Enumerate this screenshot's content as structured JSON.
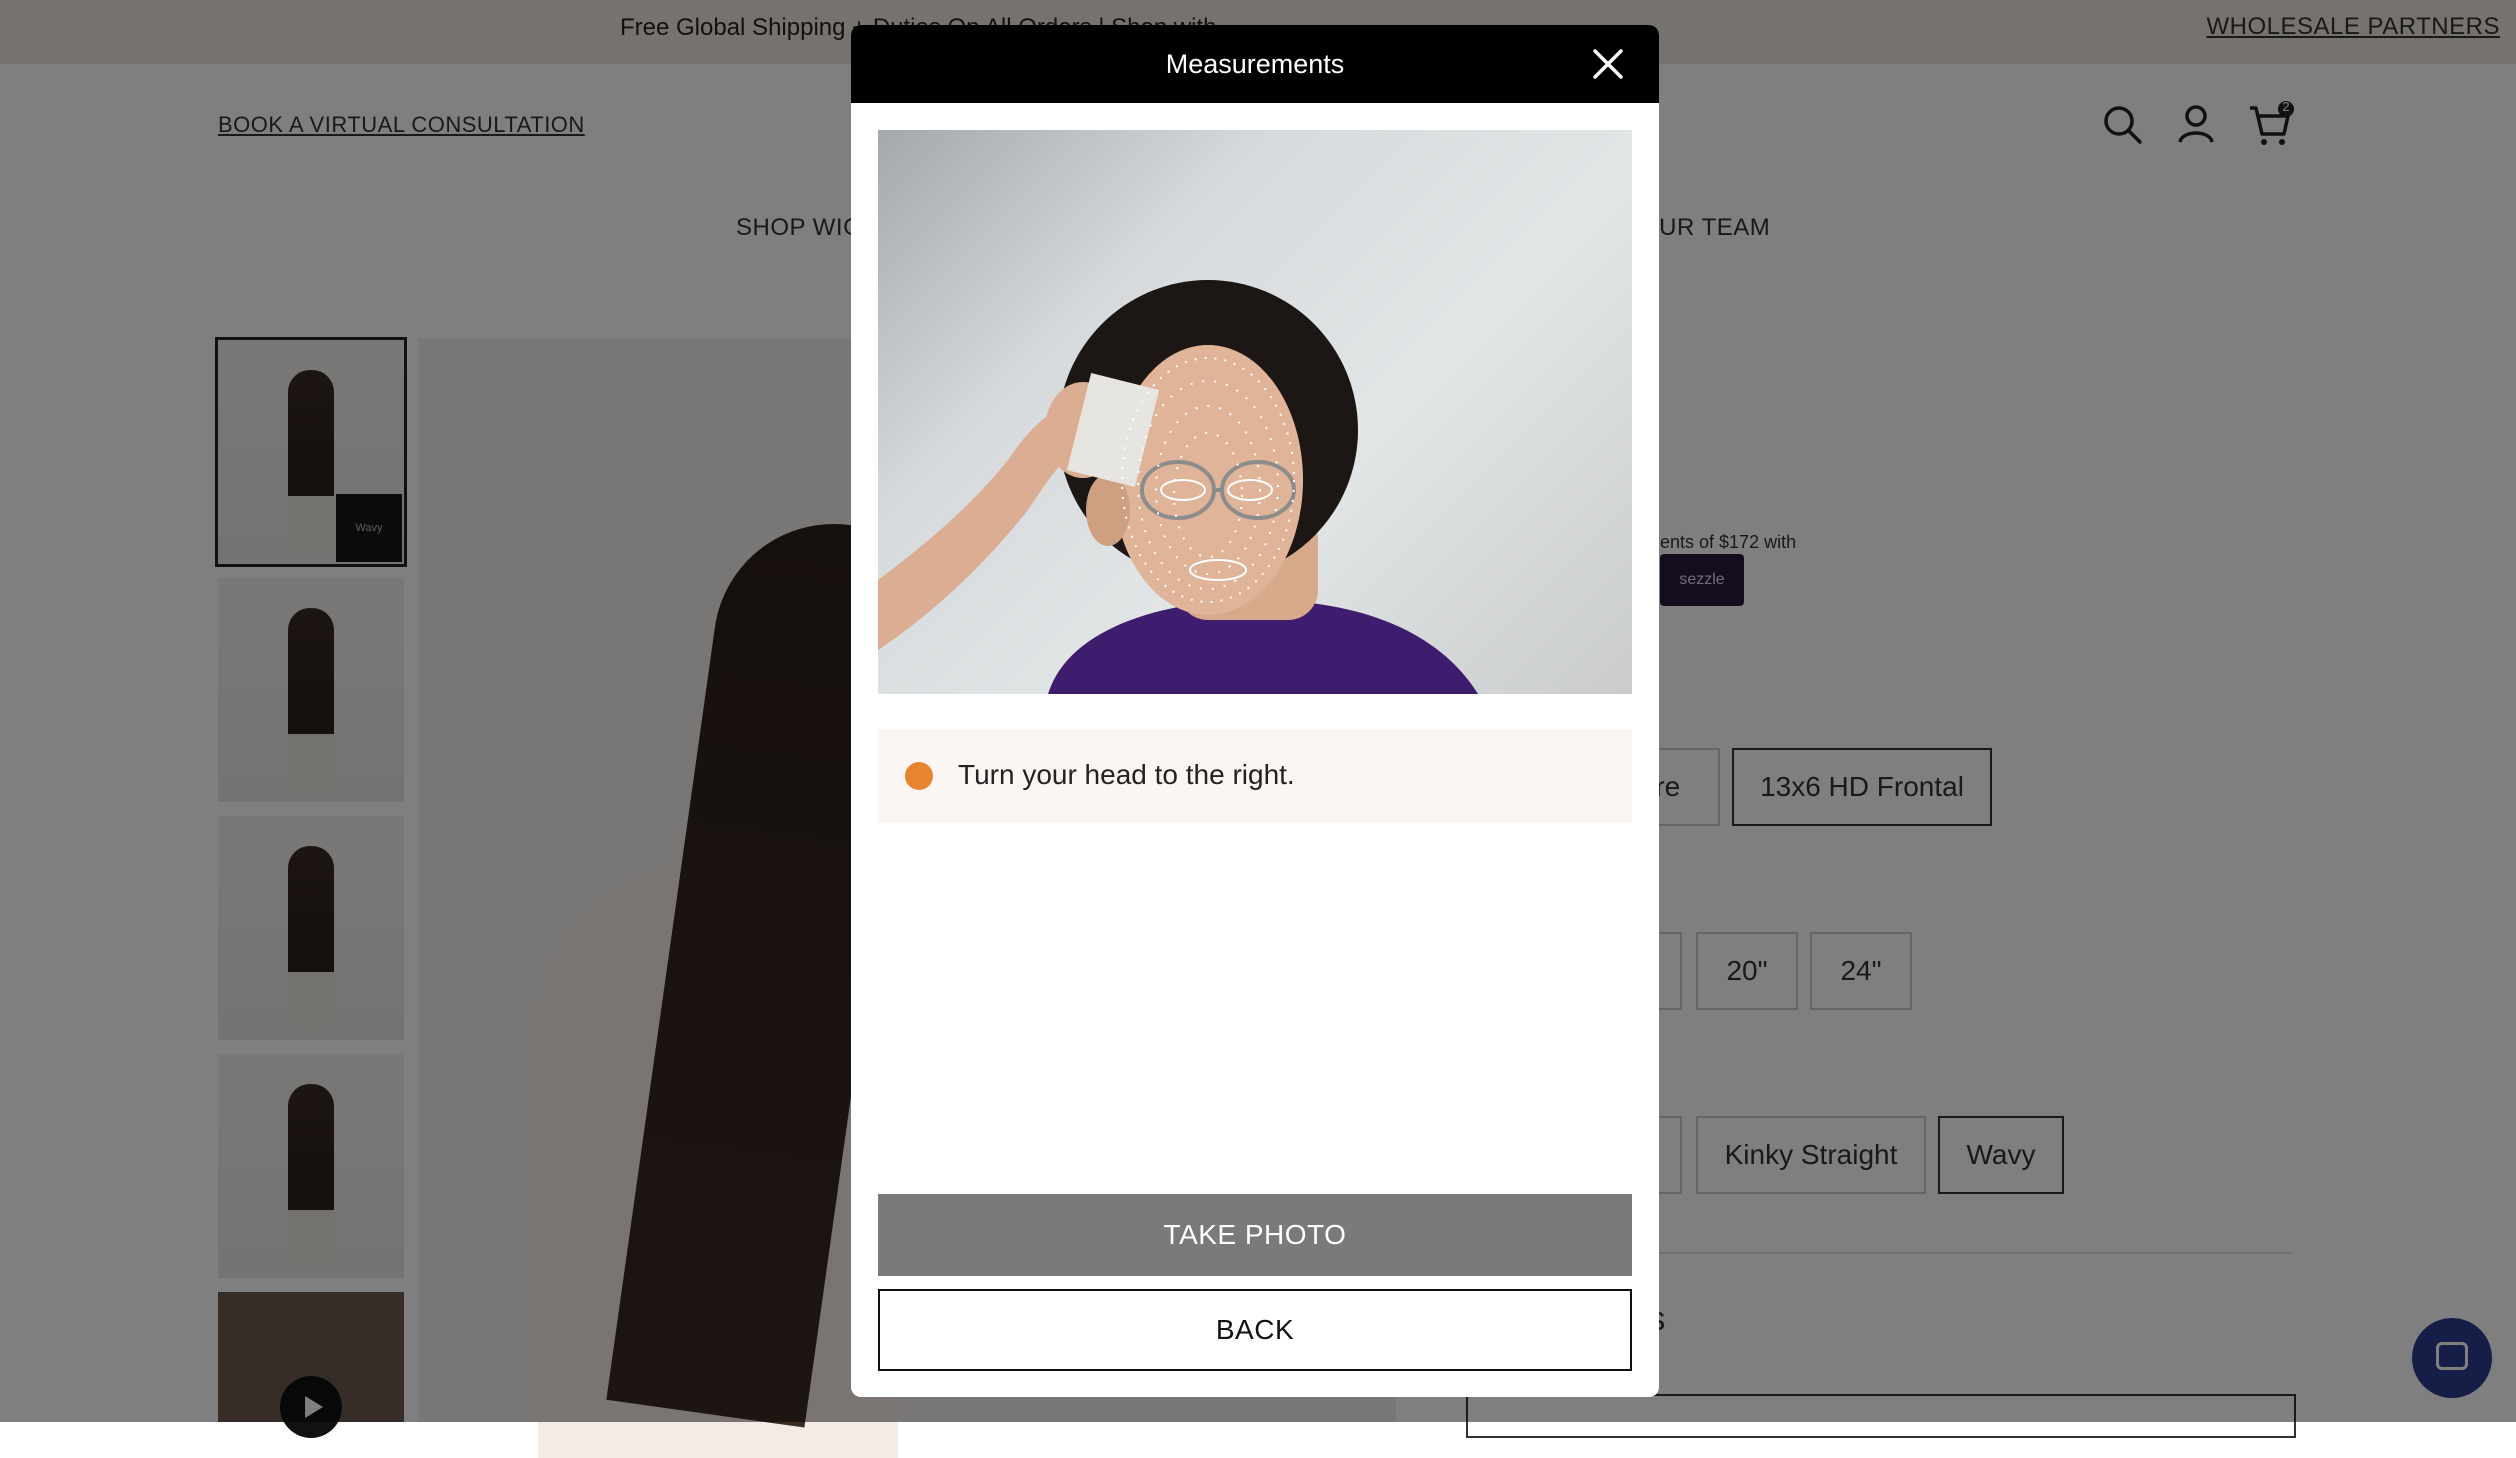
{
  "announcement": {
    "message": "Free Global Shipping + Duties On All Orders | Shop with",
    "wholesale": "WHOLESALE PARTNERS"
  },
  "header": {
    "book_consultation": "BOOK A VIRTUAL CONSULTATION",
    "cart_count": "2",
    "nav": [
      "SHOP WIG",
      "OUR TEAM"
    ]
  },
  "product": {
    "installments_text": "ents of $172 with",
    "sezzle_label": "sezzle",
    "lace_options": [
      "ure",
      "13x6 HD Frontal"
    ],
    "length_options": [
      "20\"",
      "24\""
    ],
    "texture_options": [
      "Kinky Straight",
      "Wavy"
    ],
    "partial_heading": "nts",
    "thumbnail_badge": "Wavy"
  },
  "modal": {
    "title": "Measurements",
    "instruction": "Turn your head to the right.",
    "take_photo": "TAKE PHOTO",
    "back": "BACK"
  },
  "colors": {
    "accent_dot": "#e8842e",
    "modal_header": "#000000",
    "take_photo_bg": "#7a7a7a"
  }
}
